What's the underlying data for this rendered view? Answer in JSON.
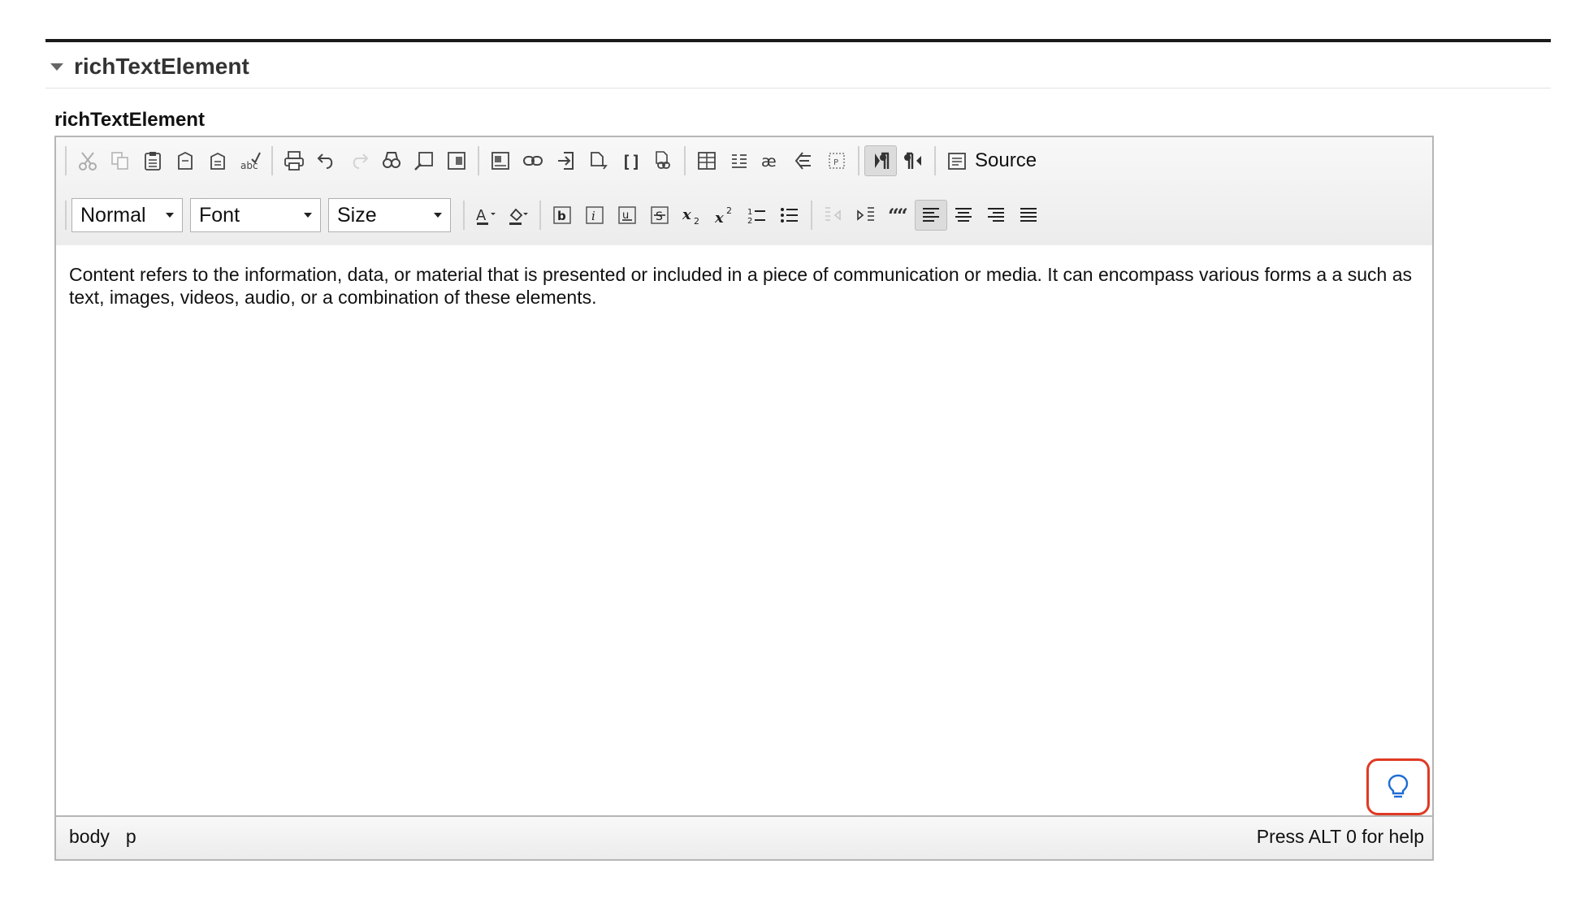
{
  "section": {
    "title": "richTextElement"
  },
  "field": {
    "label": "richTextElement"
  },
  "toolbar": {
    "row1": {
      "groups": [
        [
          "cut-icon",
          "copy-icon",
          "paste-icon",
          "paste-text-icon",
          "paste-word-icon",
          "spellcheck-icon"
        ],
        [
          "print-icon",
          "undo-icon",
          "redo-icon",
          "find-icon",
          "replace-icon",
          "select-all-icon"
        ],
        [
          "image-icon",
          "link-icon",
          "anchor-icon",
          "page-break-icon",
          "brackets-icon",
          "link-special-icon"
        ],
        [
          "table-icon",
          "horizontal-rule-icon",
          "special-char-icon",
          "remove-format-icon",
          "placeholder-icon"
        ],
        [
          "text-direction-ltr-icon",
          "text-direction-rtl-icon"
        ]
      ],
      "source_label": "Source"
    },
    "row2": {
      "format": "Normal",
      "font": "Font",
      "size": "Size",
      "groups": [
        [
          "text-color-icon",
          "background-color-icon"
        ],
        [
          "bold-icon",
          "italic-icon",
          "underline-icon",
          "strikethrough-icon",
          "subscript-icon",
          "superscript-icon",
          "numbered-list-icon",
          "bulleted-list-icon"
        ],
        [
          "outdent-icon",
          "indent-icon",
          "blockquote-icon",
          "align-left-icon",
          "align-center-icon",
          "align-right-icon",
          "align-justify-icon"
        ]
      ]
    }
  },
  "content": {
    "text": "Content refers to the information, data, or material that is presented or included in a piece of communication or media. It can encompass various forms a a such as text, images, videos, audio, or a combination of these elements."
  },
  "statusbar": {
    "path": [
      "body",
      "p"
    ],
    "help": "Press ALT 0 for help"
  },
  "colors": {
    "hint_border": "#e03a24",
    "hint_icon": "#1e6bd6"
  }
}
